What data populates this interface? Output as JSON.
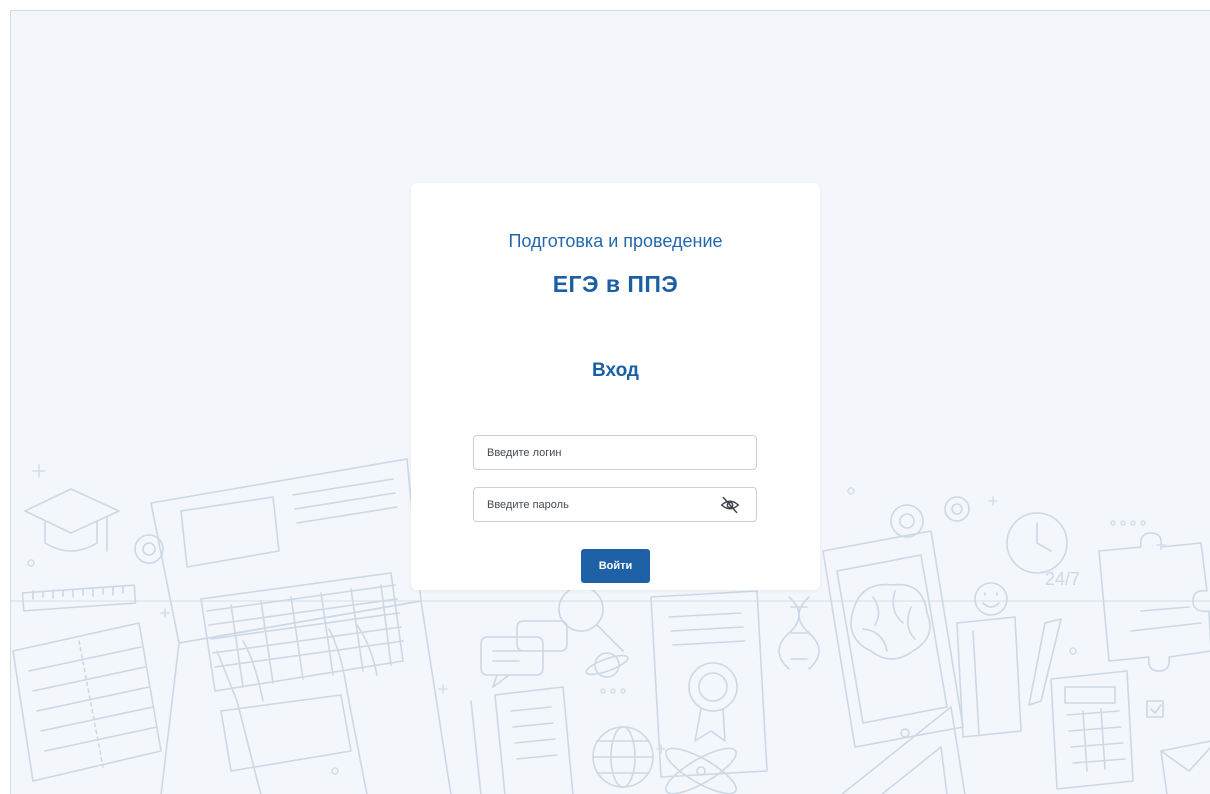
{
  "app": {
    "subtitle": "Подготовка и проведение",
    "title": "ЕГЭ в ППЭ"
  },
  "login_form": {
    "heading": "Вход",
    "login_field": {
      "value": "",
      "placeholder": "Введите логин"
    },
    "password_field": {
      "value": "",
      "placeholder": "Введите пароль",
      "toggle_icon": "eye-off-icon"
    },
    "submit_label": "Войти"
  },
  "background": {
    "illustration_text": "24/7"
  },
  "colors": {
    "primary": "#1f61a6",
    "text_accent": "#2468ac",
    "page_background": "#f3f6fa",
    "card_background": "#ffffff",
    "illustration_line": "#cdd8e6"
  }
}
